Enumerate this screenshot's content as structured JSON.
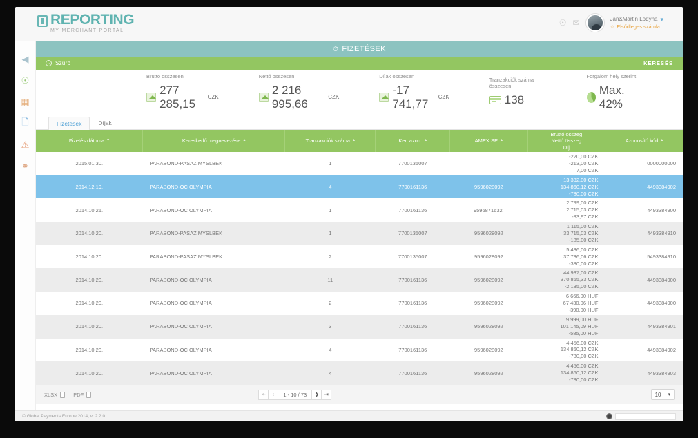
{
  "header": {
    "logo_title": "REPORTING",
    "logo_sub": "MY MERCHANT PORTAL",
    "bell_icon": "bell-icon",
    "mail_icon": "mail-icon",
    "user_name": "Jan&Martin Lodyha",
    "user_sub": "Elsődleges számla",
    "caret": "▾"
  },
  "sidebar": {
    "items": [
      {
        "name": "collapse-icon",
        "glyph": "‹",
        "color": "#9bb9c6"
      },
      {
        "name": "payments-icon",
        "glyph": "◔",
        "color": "#86bf5e"
      },
      {
        "name": "card-icon",
        "glyph": "▤",
        "color": "#e0a064"
      },
      {
        "name": "documents-icon",
        "glyph": "❐",
        "color": "#7fb4de"
      },
      {
        "name": "alerts-icon",
        "glyph": "⚠",
        "color": "#e08b5e"
      },
      {
        "name": "user-icon",
        "glyph": "⚹",
        "color": "#d8956a"
      }
    ]
  },
  "titlebar": {
    "icon": "clock-icon",
    "title": "FIZETÉSEK"
  },
  "filterbar": {
    "toggle_icon": "⬇",
    "filter_label": "Szűrő",
    "search_label": "KERESÉS"
  },
  "stats": [
    {
      "label": "Bruttó összesen",
      "value": "277 285,15",
      "currency": "CZK",
      "icon": "chart-icon"
    },
    {
      "label": "Nettó összesen",
      "value": "2 216 995,66",
      "currency": "CZK",
      "icon": "chart-icon"
    },
    {
      "label": "Díjak összesen",
      "value": "-17 741,77",
      "currency": "CZK",
      "icon": "chart-icon"
    },
    {
      "label": "Tranzakciók száma összesen",
      "value": "138",
      "currency": "",
      "icon": "card-icon"
    },
    {
      "label": "Forgalom hely szerint",
      "value": "Max. 42%",
      "currency": "",
      "icon": "pie-icon"
    }
  ],
  "tabs": [
    {
      "label": "Fizetések",
      "active": true
    },
    {
      "label": "Díjak",
      "active": false
    }
  ],
  "table": {
    "columns": [
      {
        "label": "Fizetés dátuma",
        "sort": "▾"
      },
      {
        "label": "Kereskedő megnevezése",
        "sort": "▴"
      },
      {
        "label": "Tranzakciók száma",
        "sort": "▴"
      },
      {
        "label": "Ker. azon.",
        "sort": "▴"
      },
      {
        "label": "AMEX SE",
        "sort": "▴"
      },
      {
        "label": "Bruttó összeg\nNettó összeg\nDíj",
        "sort": "▴"
      },
      {
        "label": "Azonosító kód",
        "sort": "▴"
      }
    ],
    "col_amount_lines": [
      "Bruttó összeg",
      "Nettó összeg",
      "Díj"
    ],
    "rows": [
      {
        "date": "2015.01.30.",
        "merchant": "PARABOND-PASAZ MYSLBEK",
        "count": "1",
        "ker": "7700135007",
        "amex": "",
        "gross": "-220,00 CZK",
        "net": "-213,00 CZK",
        "fee": "7,00 CZK",
        "code": "0000000000",
        "selected": false
      },
      {
        "date": "2014.12.19.",
        "merchant": "PARABOND-OC OLYMPIA",
        "count": "4",
        "ker": "7700161136",
        "amex": "9596028092",
        "gross": "13 332,00 CZK",
        "net": "134 860,12 CZK",
        "fee": "-780,00 CZK",
        "code": "4493384902",
        "selected": true
      },
      {
        "date": "2014.10.21.",
        "merchant": "PARABOND-OC OLYMPIA",
        "count": "1",
        "ker": "7700161136",
        "amex": "9596871632.",
        "gross": "2 799,00 CZK",
        "net": "2 715,03 CZK",
        "fee": "-83,97 CZK",
        "code": "4493384900",
        "selected": false
      },
      {
        "date": "2014.10.20.",
        "merchant": "PARABOND-PASAZ MYSLBEK",
        "count": "1",
        "ker": "7700135007",
        "amex": "9596028092",
        "gross": "1 115,00 CZK",
        "net": "33 715,03 CZK",
        "fee": "-185,00 CZK",
        "code": "4493384910",
        "selected": false
      },
      {
        "date": "2014.10.20.",
        "merchant": "PARABOND-PASAZ MYSLBEK",
        "count": "2",
        "ker": "7700135007",
        "amex": "9596028092",
        "gross": "5 436,00 CZK",
        "net": "37 736,06 CZK",
        "fee": "-380,00 CZK",
        "code": "5493384910",
        "selected": false
      },
      {
        "date": "2014.10.20.",
        "merchant": "PARABOND-OC OLYMPIA",
        "count": "11",
        "ker": "7700161136",
        "amex": "9596028092",
        "gross": "44 937,00 CZK",
        "net": "370 865,33 CZK",
        "fee": "-2 135,00 CZK",
        "code": "4493384900",
        "selected": false
      },
      {
        "date": "2014.10.20.",
        "merchant": "PARABOND-OC OLYMPIA",
        "count": "2",
        "ker": "7700161136",
        "amex": "9596028092",
        "gross": "6 666,00 HUF",
        "net": "67 430,06 HUF",
        "fee": "-390,00 HUF",
        "code": "4493384900",
        "selected": false
      },
      {
        "date": "2014.10.20.",
        "merchant": "PARABOND-OC OLYMPIA",
        "count": "3",
        "ker": "7700161136",
        "amex": "9596028092",
        "gross": "9 999,00 HUF",
        "net": "101 145,09 HUF",
        "fee": "-585,00 HUF",
        "code": "4493384901",
        "selected": false
      },
      {
        "date": "2014.10.20.",
        "merchant": "PARABOND-OC OLYMPIA",
        "count": "4",
        "ker": "7700161136",
        "amex": "9596028092",
        "gross": "4 456,00 CZK",
        "net": "134 860,12 CZK",
        "fee": "-780,00 CZK",
        "code": "4493384902",
        "selected": false
      },
      {
        "date": "2014.10.20.",
        "merchant": "PARABOND-OC OLYMPIA",
        "count": "4",
        "ker": "7700161136",
        "amex": "9596028092",
        "gross": "4 456,00 CZK",
        "net": "134 860,12 CZK",
        "fee": "-780,00 CZK",
        "code": "4493384903",
        "selected": false
      }
    ]
  },
  "footer": {
    "xlsx_label": "XLSX",
    "pdf_label": "PDF",
    "first_glyph": "⏮",
    "prev_glyph": "‹",
    "page_info": "1 - 10 / 73",
    "next_glyph": "❯",
    "last_glyph": "⏭",
    "page_size": "10",
    "page_size_caret": "▾"
  },
  "statusbar": {
    "copyright": "© Global Payments Europe 2014, v: 2.2.0"
  },
  "colors": {
    "brand_teal": "#5fb3b0",
    "title_teal": "#8cc3c0",
    "green": "#93c661",
    "selection_blue": "#7ec2ea",
    "tab_active": "#4a9ed4"
  }
}
